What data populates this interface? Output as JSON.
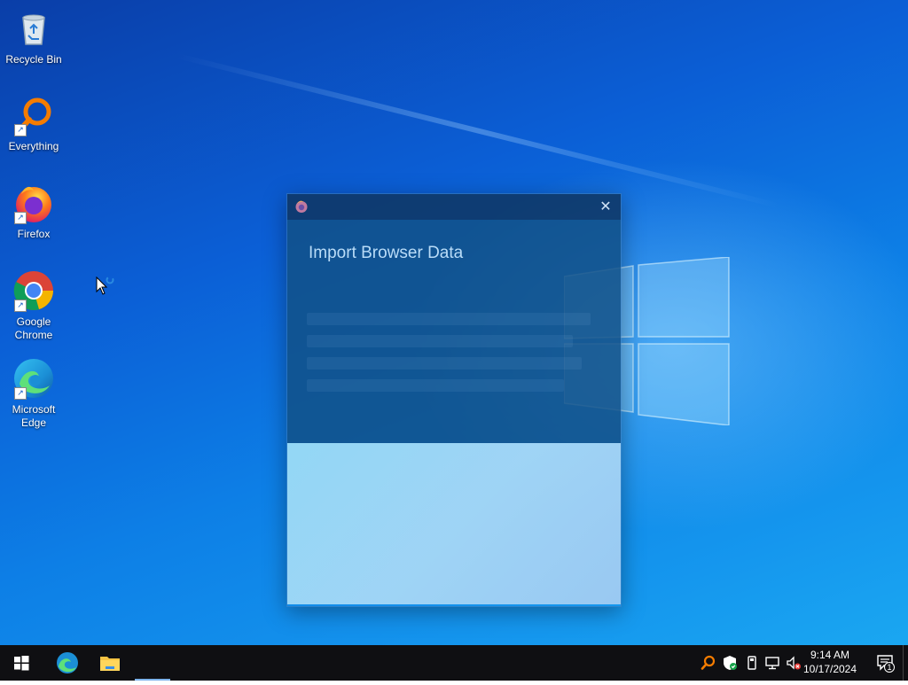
{
  "desktop": {
    "icons": [
      {
        "label": "Recycle Bin",
        "icon": "recycle-bin-icon"
      },
      {
        "label": "Everything",
        "icon": "everything-icon"
      },
      {
        "label": "Firefox",
        "icon": "firefox-icon"
      },
      {
        "label": "Google Chrome",
        "icon": "chrome-icon"
      },
      {
        "label": "Microsoft Edge",
        "icon": "edge-icon"
      }
    ]
  },
  "dialog": {
    "title": "Import Browser Data",
    "close_symbol": "✕",
    "app_icon": "firefox-icon"
  },
  "taskbar": {
    "start_icon": "windows-start-icon",
    "pinned": [
      "edge-icon",
      "file-explorer-icon"
    ],
    "tray_icons": [
      "everything-icon",
      "windows-security-icon",
      "usb-device-icon",
      "network-icon",
      "volume-muted-icon"
    ],
    "time": "9:14 AM",
    "date": "10/17/2024",
    "notification_count": "1"
  },
  "colors": {
    "desktop_blue": "#0b5fd6",
    "taskbar": "#0f0f12",
    "dialog_header": "#125087",
    "dialog_body": "#9adcf6"
  }
}
